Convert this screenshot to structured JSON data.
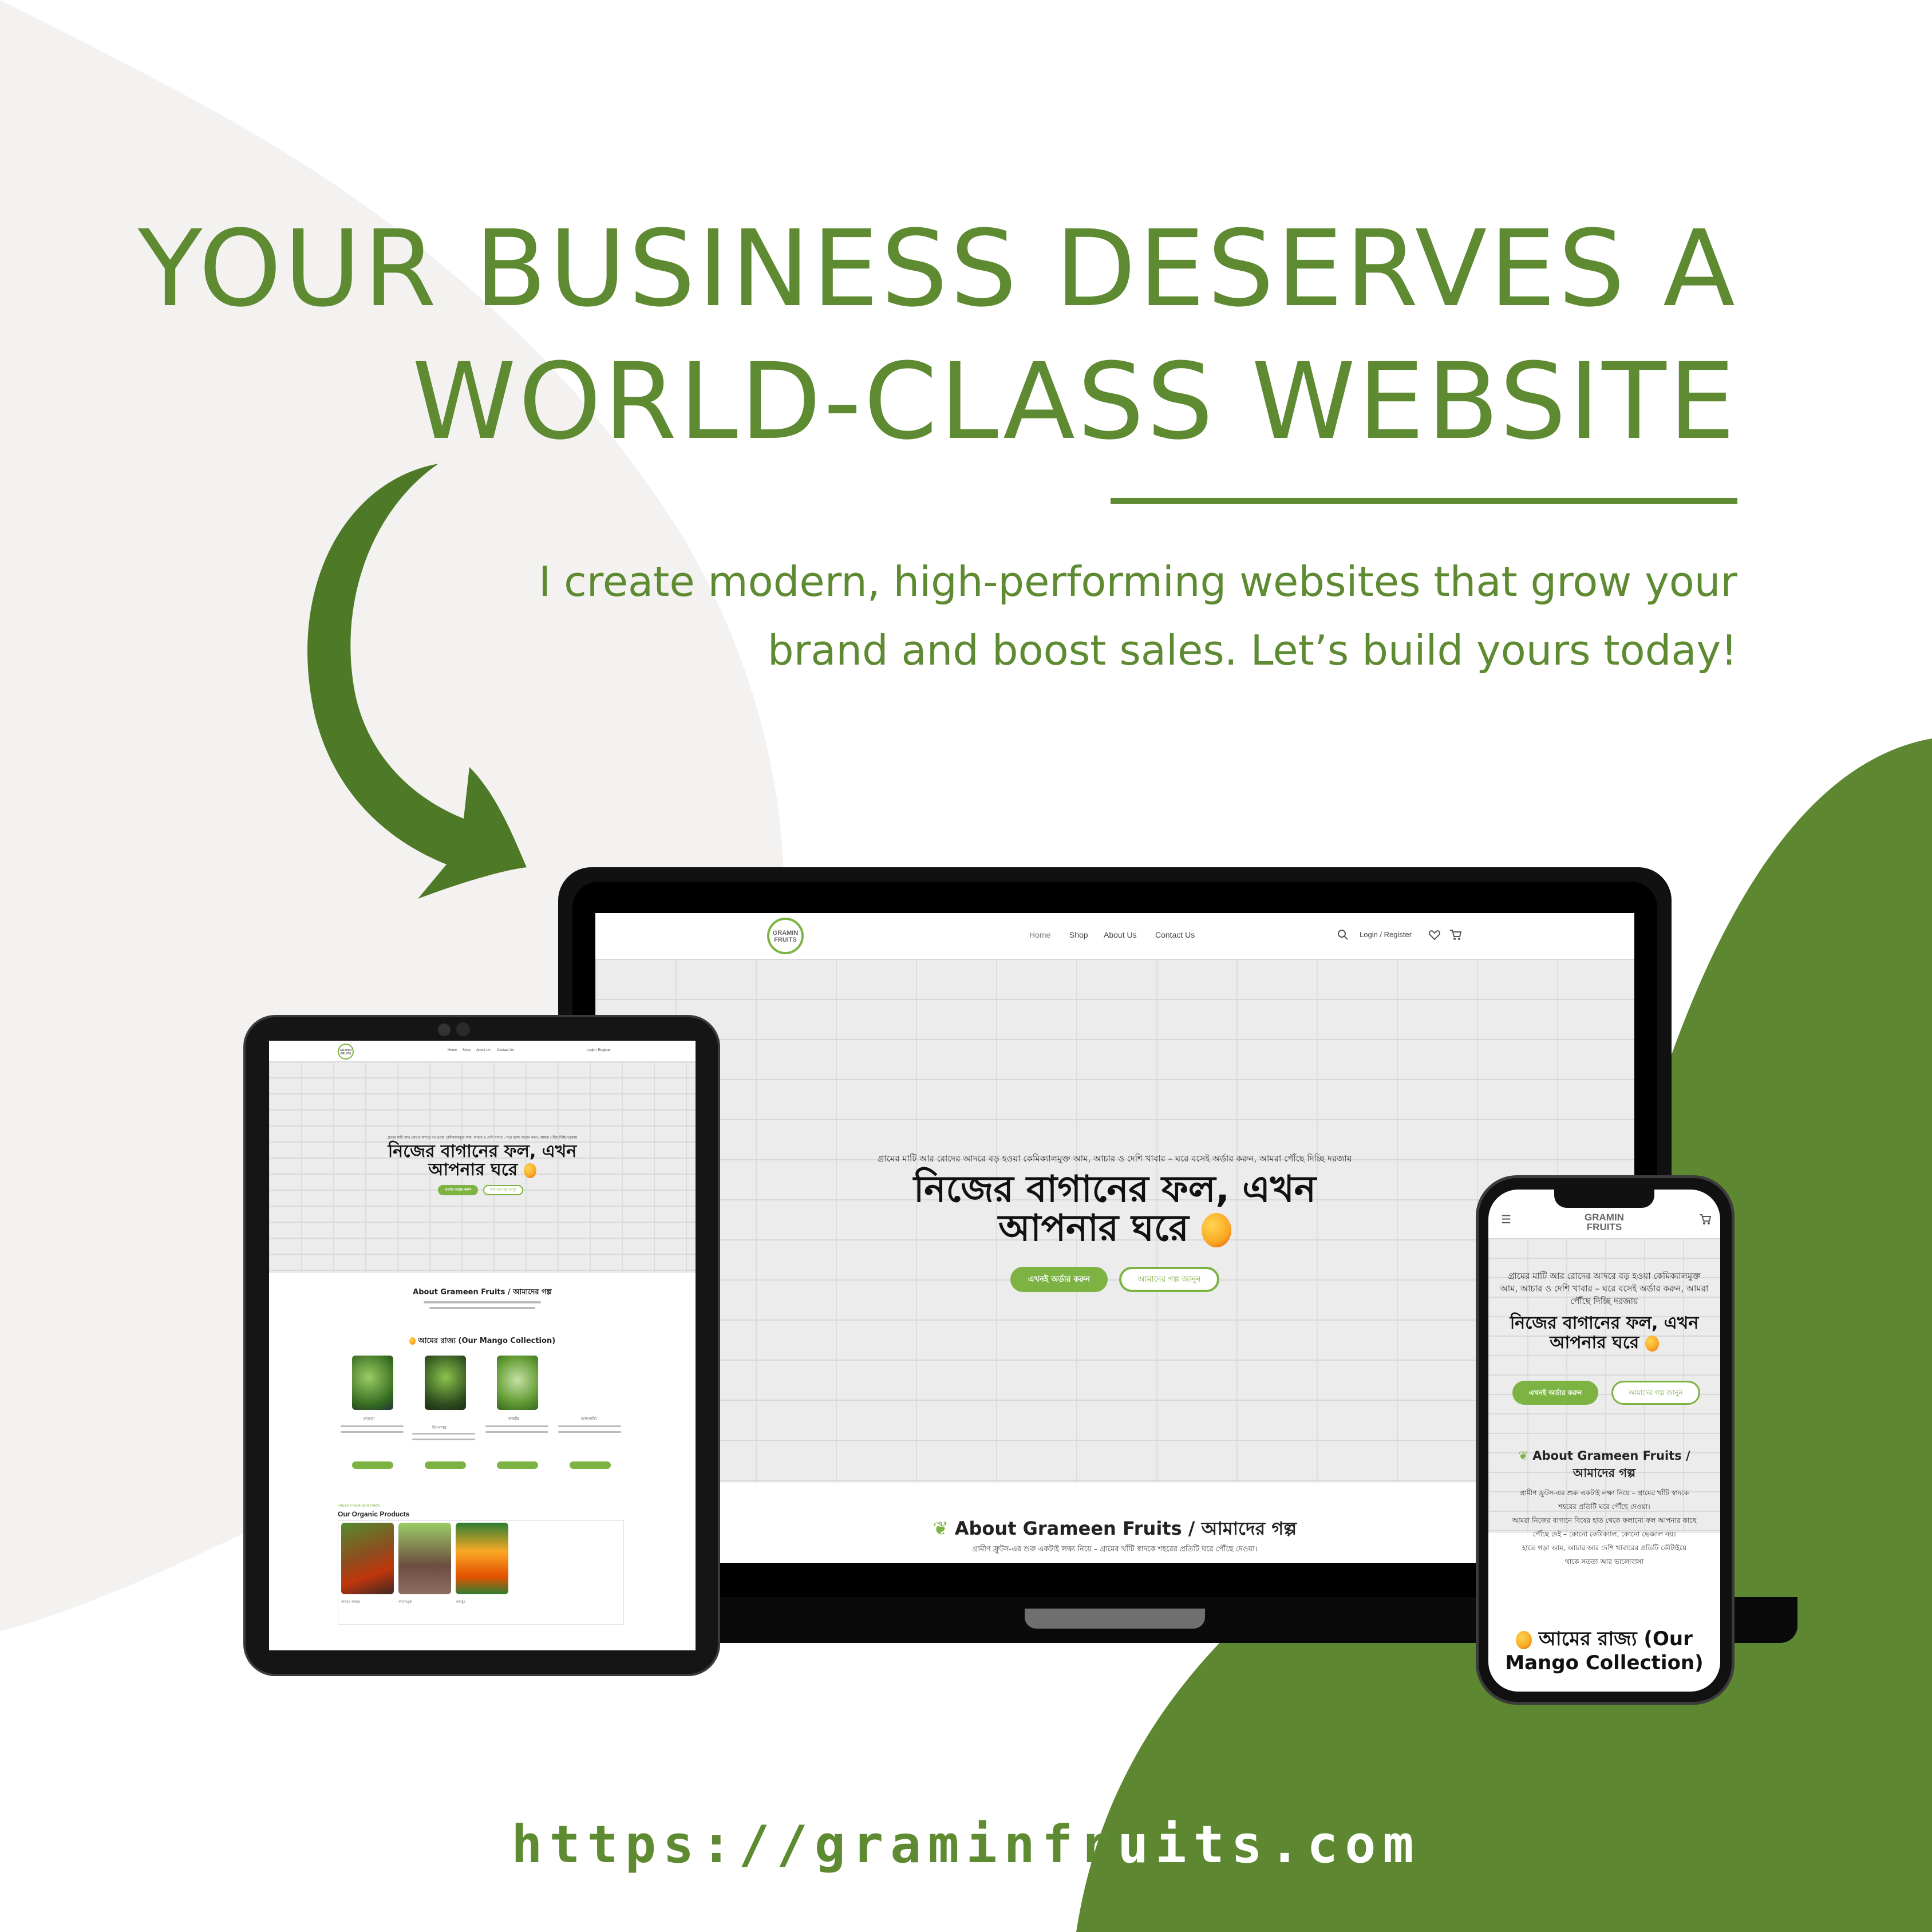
{
  "headline": {
    "line1": "YOUR BUSINESS DESERVES A",
    "line2": "WORLD-CLASS WEBSITE"
  },
  "subtext": {
    "line1": "I create modern, high-performing websites that grow your",
    "line2": "brand and boost sales. Let’s build yours today!"
  },
  "url": {
    "part1": "https://graminfr",
    "part2": "uits.com"
  },
  "colors": {
    "brand_green": "#5e8a32",
    "dark_green": "#5d8731",
    "light_gray_blob": "#f3f2f0",
    "button_green": "#7cb342"
  },
  "site": {
    "logo_line1": "GRAMIN",
    "logo_line2": "FRUITS",
    "nav": [
      "Home",
      "Shop",
      "About Us",
      "Contact Us"
    ],
    "login": "Login / Register",
    "icons": [
      "search-icon",
      "heart-icon",
      "cart-icon",
      "menu-icon"
    ],
    "hero_small": "গ্রামের মাটি আর রোদের আদরে বড় হওয়া কেমিক্যালমুক্ত আম, আচার ও দেশি খাবার – ঘরে বসেই অর্ডার করুন, আমরা পৌঁছে দিচ্ছি দরজায়",
    "hero_big_line1": "নিজের বাগানের ফল, এখন",
    "hero_big_line2": "আপনার ঘরে",
    "btn_order": "এখনই অর্ডার করুন",
    "btn_story": "আমাদের গল্প জানুন",
    "about_title": "About Grameen Fruits / আমাদের গল্প",
    "about_text": "গ্রামীণ ফ্রুটস-এর শুরু একটাই লক্ষ্য নিয়ে – গ্রামের খাঁটি স্বাদকে শহরের প্রতিটি ঘরে পৌঁছে দেওয়া।",
    "mango_collection_title": "আমের রাজ্য (Our Mango Collection)",
    "organic_title": "Our Organic Products",
    "organic_tag": "FRESH FROM OUR FARM",
    "mango_names": [
      "ল্যাংড়া",
      "হিমসাগর",
      "ফজলি",
      "আম্রপালি"
    ],
    "products": [
      {
        "name": "আমের আচার"
      },
      {
        "name": "আমসত্ত্ব"
      },
      {
        "name": "আমচুর"
      }
    ],
    "phone_about_text": [
      "গ্রামীণ ফ্রুটস-এর শুরু একটাই লক্ষ্য নিয়ে – গ্রামের খাঁটি স্বাদকে",
      "শহরের প্রতিটি ঘরে পৌঁছে দেওয়া।",
      "আমরা নিজের বাগানে বিষের হাত থেকে ফলানো ফল আপনার কাছে",
      "পৌঁছে দেই – কোনো কেমিক্যাল, কোনো ভেজাল নয়।",
      "হাতে গড়া আম, আচার আর দেশি খাবারের প্রতিটি কৌটাইয়ে",
      "থাকে সততা আর ভালোবাসা"
    ],
    "phone_mango_line1": "আমের রাজ্য (Our",
    "phone_mango_line2": "Mango Collection)"
  }
}
